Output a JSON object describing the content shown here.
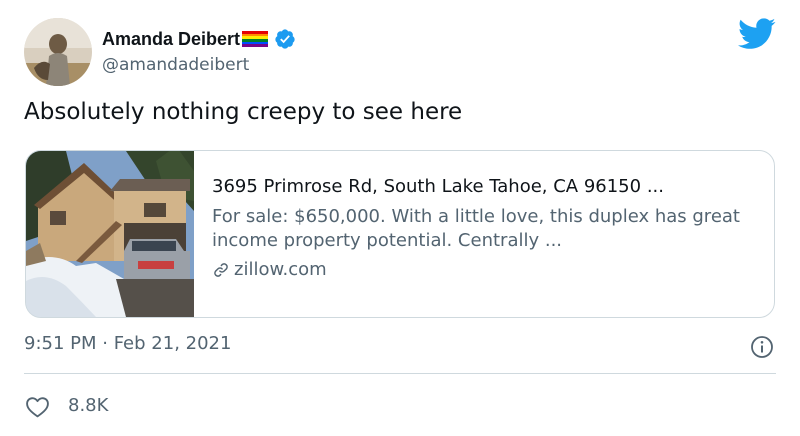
{
  "author": {
    "display_name": "Amanda Deibert",
    "handle": "@amandadeibert"
  },
  "tweet": {
    "text": "Absolutely nothing creepy to see here"
  },
  "card": {
    "title": "3695 Primrose Rd, South Lake Tahoe, CA 96150 ...",
    "description": "For sale: $650,000. With a little love, this duplex has great income property potential. Centrally ...",
    "domain": "zillow.com"
  },
  "meta": {
    "timestamp": "9:51 PM · Feb 21, 2021"
  },
  "engagement": {
    "likes": "8.8K"
  },
  "colors": {
    "accent": "#1d9bf0",
    "text_primary": "#0f1419",
    "text_secondary": "#536471",
    "border": "#cfd9de",
    "twitter_blue": "#1da1f2"
  },
  "icons": {
    "verified": "verified-badge-icon",
    "logo": "twitter-bird-icon",
    "link": "link-icon",
    "info": "info-icon",
    "like": "heart-icon",
    "flag": "rainbow-flag-icon"
  }
}
